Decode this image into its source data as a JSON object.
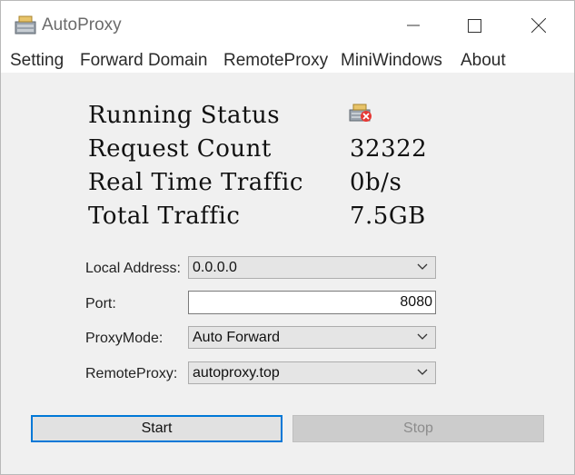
{
  "window": {
    "title": "AutoProxy"
  },
  "menu": [
    "Setting",
    "Forward Domain",
    "RemoteProxy",
    "MiniWindows",
    "About"
  ],
  "status": {
    "running_label": "Running Status",
    "running_icon": "stopped-server-icon",
    "request_label": "Request Count",
    "request_value": "32322",
    "realtime_label": "Real Time Traffic",
    "realtime_value": "0b/s",
    "total_label": "Total Traffic",
    "total_value": "7.5GB"
  },
  "form": {
    "local_address_label": "Local Address:",
    "local_address_value": "0.0.0.0",
    "port_label": "Port:",
    "port_value": "8080",
    "proxy_mode_label": "ProxyMode:",
    "proxy_mode_value": "Auto Forward",
    "remote_proxy_label": "RemoteProxy:",
    "remote_proxy_value": "autoproxy.top"
  },
  "buttons": {
    "start": "Start",
    "stop": "Stop"
  },
  "colors": {
    "accent": "#0078d7",
    "status_error": "#e53935"
  }
}
